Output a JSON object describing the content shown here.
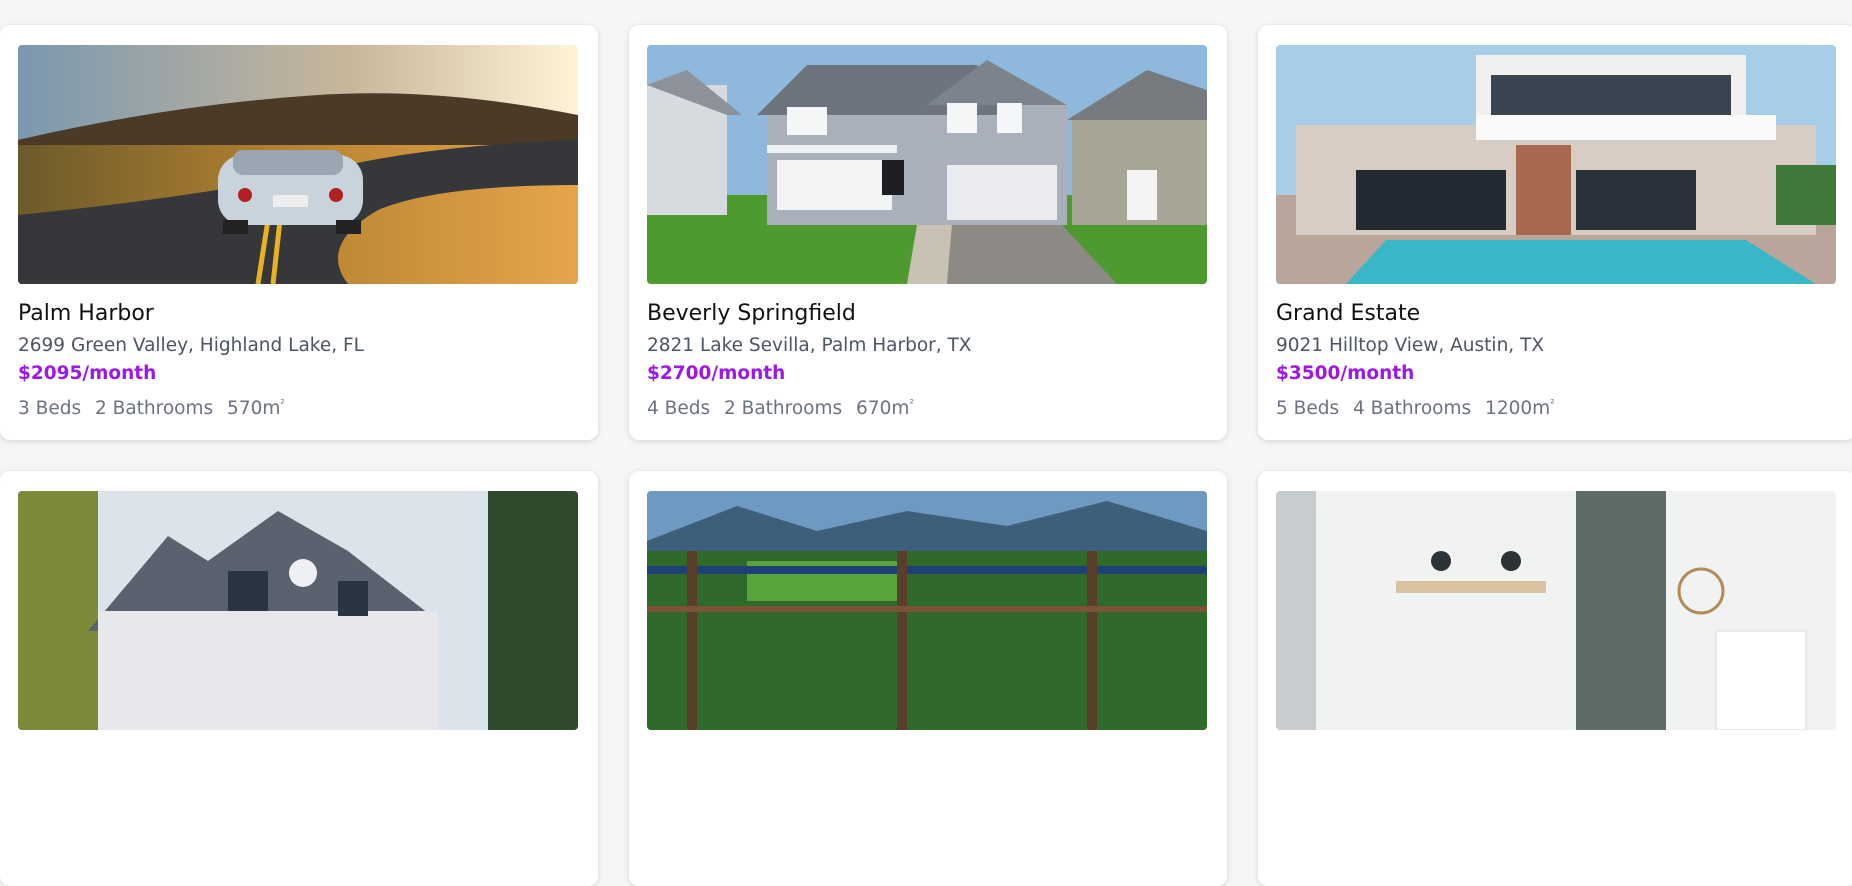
{
  "listings": [
    {
      "title": "Palm Harbor",
      "address": "2699 Green Valley, Highland Lake, FL",
      "price": "$2095/month",
      "beds": "3 Beds",
      "baths": "2 Bathrooms",
      "area": "570m",
      "area_unit": "²",
      "image": "car-on-road-photo"
    },
    {
      "title": "Beverly Springfield",
      "address": "2821 Lake Sevilla, Palm Harbor, TX",
      "price": "$2700/month",
      "beds": "4 Beds",
      "baths": "2 Bathrooms",
      "area": "670m",
      "area_unit": "²",
      "image": "suburban-house-photo"
    },
    {
      "title": "Grand Estate",
      "address": "9021 Hilltop View, Austin, TX",
      "price": "$3500/month",
      "beds": "5 Beds",
      "baths": "4 Bathrooms",
      "area": "1200m",
      "area_unit": "²",
      "image": "modern-villa-pool-photo"
    },
    {
      "image": "victorian-house-photo"
    },
    {
      "image": "mountain-balcony-view-photo"
    },
    {
      "image": "bright-interior-kitchen-photo"
    }
  ],
  "colors": {
    "price": "#9b18e8",
    "page_bg": "#f5f6f8",
    "card_bg": "#ffffff"
  }
}
